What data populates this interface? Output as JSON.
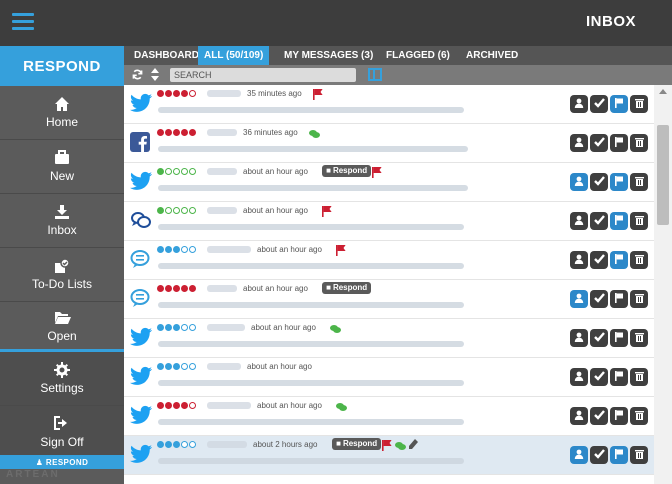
{
  "header": {
    "title": "INBOX"
  },
  "sidebar": {
    "brand": "RESPOND",
    "items": [
      {
        "label": "Home",
        "icon": "home-icon"
      },
      {
        "label": "New",
        "icon": "briefcase-icon"
      },
      {
        "label": "Inbox",
        "icon": "inbox-download-icon"
      },
      {
        "label": "To-Do Lists",
        "icon": "todo-stack-icon"
      },
      {
        "label": "Open",
        "icon": "folder-open-icon"
      },
      {
        "label": "Settings",
        "icon": "gear-icon"
      },
      {
        "label": "Sign Off",
        "icon": "sign-off-icon"
      }
    ],
    "footer_label": "RESPOND",
    "logo_text": "ARTEAN"
  },
  "tabs": [
    {
      "label": "DASHBOARD",
      "active": false
    },
    {
      "label": "ALL (50/109)",
      "active": true
    },
    {
      "label": "MY MESSAGES (3)",
      "active": false
    },
    {
      "label": "FLAGGED (6)",
      "active": false
    },
    {
      "label": "ARCHIVED",
      "active": false
    }
  ],
  "toolbar": {
    "search_placeholder": "SEARCH",
    "refresh_icon": "refresh-icon",
    "sort_icon": "sort-icon",
    "columns_icon": "columns-icon"
  },
  "messages": [
    {
      "source": "twitter",
      "rating": 4,
      "dot_color": "#cc1f32",
      "time": "35 minutes ago",
      "respond": false,
      "flag": true,
      "chat": false,
      "pencil": false,
      "selected": false
    },
    {
      "source": "facebook",
      "rating": 5,
      "dot_color": "#cc1f32",
      "time": "36 minutes ago",
      "respond": false,
      "flag": false,
      "chat": true,
      "pencil": false,
      "selected": false
    },
    {
      "source": "twitter",
      "rating": 1,
      "dot_color": "#4cb54a",
      "time": "about an hour ago",
      "respond": true,
      "flag": true,
      "chat": false,
      "pencil": false,
      "selected": false
    },
    {
      "source": "chat",
      "rating": 1,
      "dot_color": "#4cb54a",
      "time": "about an hour ago",
      "respond": false,
      "flag": true,
      "chat": false,
      "pencil": false,
      "selected": false
    },
    {
      "source": "speech",
      "rating": 3,
      "dot_color": "#35a0dc",
      "time": "about an hour ago",
      "respond": false,
      "flag": true,
      "chat": false,
      "pencil": false,
      "selected": false
    },
    {
      "source": "speech",
      "rating": 5,
      "dot_color": "#cc1f32",
      "time": "about an hour ago",
      "respond": true,
      "flag": false,
      "chat": false,
      "pencil": false,
      "selected": false
    },
    {
      "source": "twitter",
      "rating": 3,
      "dot_color": "#35a0dc",
      "time": "about an hour ago",
      "respond": false,
      "flag": false,
      "chat": true,
      "pencil": false,
      "selected": false
    },
    {
      "source": "twitter",
      "rating": 3,
      "dot_color": "#35a0dc",
      "time": "about an hour ago",
      "respond": false,
      "flag": false,
      "chat": false,
      "pencil": false,
      "selected": false
    },
    {
      "source": "twitter",
      "rating": 4,
      "dot_color": "#cc1f32",
      "time": "about an hour ago",
      "respond": false,
      "flag": false,
      "chat": true,
      "pencil": false,
      "selected": false
    },
    {
      "source": "twitter",
      "rating": 3,
      "dot_color": "#35a0dc",
      "time": "about 2 hours ago",
      "respond": true,
      "flag": true,
      "chat": true,
      "pencil": true,
      "selected": true
    }
  ],
  "respond_label": "Respond",
  "colors": {
    "accent": "#35a0dc",
    "topbar": "#3d3d3d",
    "sidebar": "#5b5b5b",
    "twitter": "#1da1f2",
    "facebook": "#3b5998",
    "flag": "#cc1f32",
    "chat": "#4cb54a"
  }
}
